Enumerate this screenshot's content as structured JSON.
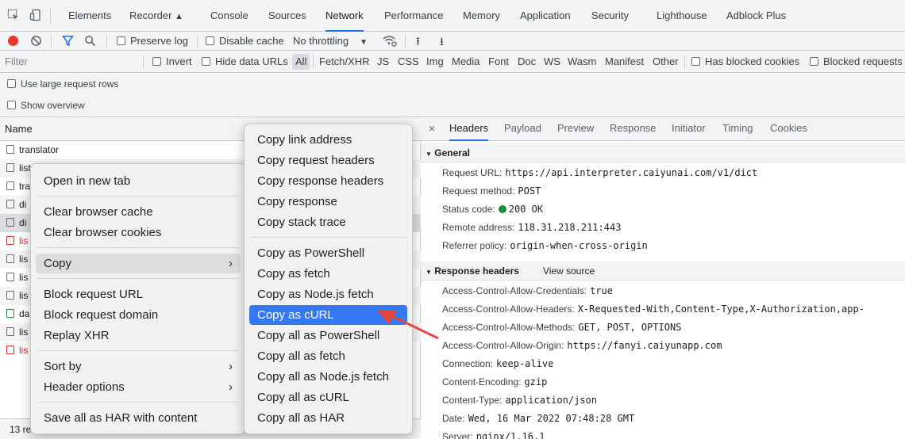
{
  "topbar": {
    "tabs": [
      "Elements",
      "Recorder",
      "Console",
      "Sources",
      "Network",
      "Performance",
      "Memory",
      "Application",
      "Security",
      "Lighthouse",
      "Adblock Plus"
    ],
    "active_tab": "Network",
    "inspect_icon": "inspect-icon",
    "device_icon": "device-toggle-icon"
  },
  "toolbar": {
    "preserve_log": "Preserve log",
    "disable_cache": "Disable cache",
    "throttling": "No throttling",
    "record_color": "#e8372c"
  },
  "filterbar": {
    "filter_placeholder": "Filter",
    "invert": "Invert",
    "hide_data_urls": "Hide data URLs",
    "types": [
      "All",
      "Fetch/XHR",
      "JS",
      "CSS",
      "Img",
      "Media",
      "Font",
      "Doc",
      "WS",
      "Wasm",
      "Manifest",
      "Other"
    ],
    "has_blocked_cookies": "Has blocked cookies",
    "blocked_requests": "Blocked requests"
  },
  "options": {
    "large_rows": "Use large request rows",
    "show_overview": "Show overview"
  },
  "reqlist": {
    "header": "Name",
    "rows": [
      "translator",
      "list",
      "tra",
      "di",
      "di",
      "lis",
      "lis",
      "lis",
      "lis",
      "da",
      "lis",
      "lis"
    ],
    "status": "13 re"
  },
  "details": {
    "close": "×",
    "tabs": [
      "Headers",
      "Payload",
      "Preview",
      "Response",
      "Initiator",
      "Timing",
      "Cookies"
    ],
    "general": {
      "title": "General",
      "request_url_k": "Request URL:",
      "request_url_v": "https://api.interpreter.caiyunai.com/v1/dict",
      "method_k": "Request method:",
      "method_v": "POST",
      "status_k": "Status code:",
      "status_v": "200 OK",
      "remote_k": "Remote address:",
      "remote_v": "118.31.218.211:443",
      "referrer_k": "Referrer policy:",
      "referrer_v": "origin-when-cross-origin"
    },
    "response_headers": {
      "title": "Response headers",
      "view_source": "View source",
      "items": [
        {
          "k": "Access-Control-Allow-Credentials:",
          "v": "true"
        },
        {
          "k": "Access-Control-Allow-Headers:",
          "v": "X-Requested-With,Content-Type,X-Authorization,app-"
        },
        {
          "k": "Access-Control-Allow-Methods:",
          "v": "GET, POST, OPTIONS"
        },
        {
          "k": "Access-Control-Allow-Origin:",
          "v": "https://fanyi.caiyunapp.com"
        },
        {
          "k": "Connection:",
          "v": "keep-alive"
        },
        {
          "k": "Content-Encoding:",
          "v": "gzip"
        },
        {
          "k": "Content-Type:",
          "v": "application/json"
        },
        {
          "k": "Date:",
          "v": "Wed, 16 Mar 2022 07:48:28 GMT"
        },
        {
          "k": "Server:",
          "v": "nginx/1.16.1"
        }
      ]
    }
  },
  "context_menu": {
    "items": [
      "Open in new tab",
      "Clear browser cache",
      "Clear browser cookies",
      "Copy",
      "Block request URL",
      "Block request domain",
      "Replay XHR",
      "Sort by",
      "Header options",
      "Save all as HAR with content"
    ]
  },
  "copy_submenu": {
    "items": [
      "Copy link address",
      "Copy request headers",
      "Copy response headers",
      "Copy response",
      "Copy stack trace",
      "Copy as PowerShell",
      "Copy as fetch",
      "Copy as Node.js fetch",
      "Copy as cURL",
      "Copy all as PowerShell",
      "Copy all as fetch",
      "Copy all as Node.js fetch",
      "Copy all as cURL",
      "Copy all as HAR"
    ],
    "highlighted": "Copy as cURL"
  },
  "colors": {
    "accent": "#1a73e8",
    "highlight": "#3478f6",
    "annotation_arrow": "#e5473c"
  }
}
